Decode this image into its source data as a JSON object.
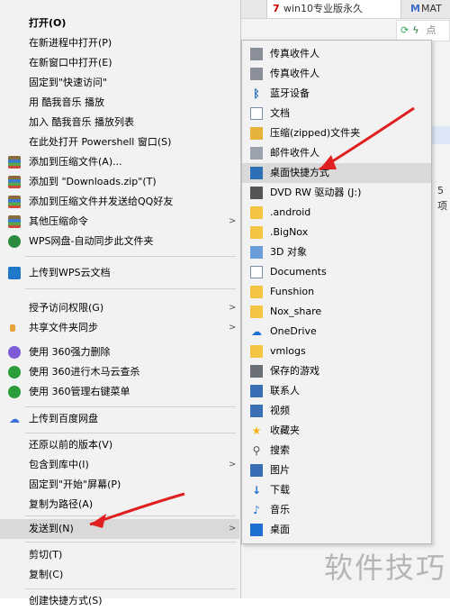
{
  "background_window": {
    "tab1_label": "win10专业版永久",
    "tab2_label": "MAT",
    "addr_tail": "点",
    "side_text_1": "5",
    "side_text_2": "项"
  },
  "context_menu": {
    "items": [
      {
        "label": "打开(O)"
      },
      {
        "label": "在新进程中打开(P)"
      },
      {
        "label": "在新窗口中打开(E)"
      },
      {
        "label": "固定到\"快速访问\""
      },
      {
        "label": "用 酷我音乐 播放"
      },
      {
        "label": "加入 酷我音乐 播放列表"
      },
      {
        "label": "在此处打开 Powershell 窗口(S)"
      },
      {
        "label": "添加到压缩文件(A)..."
      },
      {
        "label": "添加到 \"Downloads.zip\"(T)"
      },
      {
        "label": "添加到压缩文件并发送给QQ好友"
      },
      {
        "label": "其他压缩命令"
      },
      {
        "label": "WPS网盘-自动同步此文件夹"
      },
      {
        "label": "上传到WPS云文档"
      },
      {
        "label": "授予访问权限(G)"
      },
      {
        "label": "共享文件夹同步"
      },
      {
        "label": "使用 360强力删除"
      },
      {
        "label": "使用 360进行木马云查杀"
      },
      {
        "label": "使用 360管理右键菜单"
      },
      {
        "label": "上传到百度网盘"
      },
      {
        "label": "还原以前的版本(V)"
      },
      {
        "label": "包含到库中(I)"
      },
      {
        "label": "固定到\"开始\"屏幕(P)"
      },
      {
        "label": "复制为路径(A)"
      },
      {
        "label": "发送到(N)"
      },
      {
        "label": "剪切(T)"
      },
      {
        "label": "复制(C)"
      },
      {
        "label": "创建快捷方式(S)"
      }
    ]
  },
  "send_to_menu": {
    "items": [
      {
        "label": "传真收件人",
        "icon": "fax-icon"
      },
      {
        "label": "传真收件人",
        "icon": "fax-icon"
      },
      {
        "label": "蓝牙设备",
        "icon": "bluetooth-icon"
      },
      {
        "label": "文档",
        "icon": "document-icon"
      },
      {
        "label": "压缩(zipped)文件夹",
        "icon": "zip-folder-icon"
      },
      {
        "label": "邮件收件人",
        "icon": "mail-icon"
      },
      {
        "label": "桌面快捷方式",
        "icon": "desktop-shortcut-icon"
      },
      {
        "label": "DVD RW 驱动器 (J:)",
        "icon": "dvd-drive-icon"
      },
      {
        "label": ".android",
        "icon": "folder-icon"
      },
      {
        "label": ".BigNox",
        "icon": "folder-icon"
      },
      {
        "label": "3D 对象",
        "icon": "3d-objects-icon"
      },
      {
        "label": "Documents",
        "icon": "document-icon"
      },
      {
        "label": "Funshion",
        "icon": "folder-icon"
      },
      {
        "label": "Nox_share",
        "icon": "folder-icon"
      },
      {
        "label": "OneDrive",
        "icon": "onedrive-icon"
      },
      {
        "label": "vmlogs",
        "icon": "folder-icon"
      },
      {
        "label": "保存的游戏",
        "icon": "saved-games-icon"
      },
      {
        "label": "联系人",
        "icon": "contacts-icon"
      },
      {
        "label": "视频",
        "icon": "video-icon"
      },
      {
        "label": "收藏夹",
        "icon": "favorites-icon"
      },
      {
        "label": "搜索",
        "icon": "search-icon"
      },
      {
        "label": "图片",
        "icon": "pictures-icon"
      },
      {
        "label": "下载",
        "icon": "download-icon"
      },
      {
        "label": "音乐",
        "icon": "music-icon"
      },
      {
        "label": "桌面",
        "icon": "desktop-icon"
      }
    ]
  },
  "watermark": "软件技巧",
  "colors": {
    "menu_bg": "#f2f2f2",
    "highlight": "#d9d9d9",
    "arrow_red": "#e02020"
  }
}
